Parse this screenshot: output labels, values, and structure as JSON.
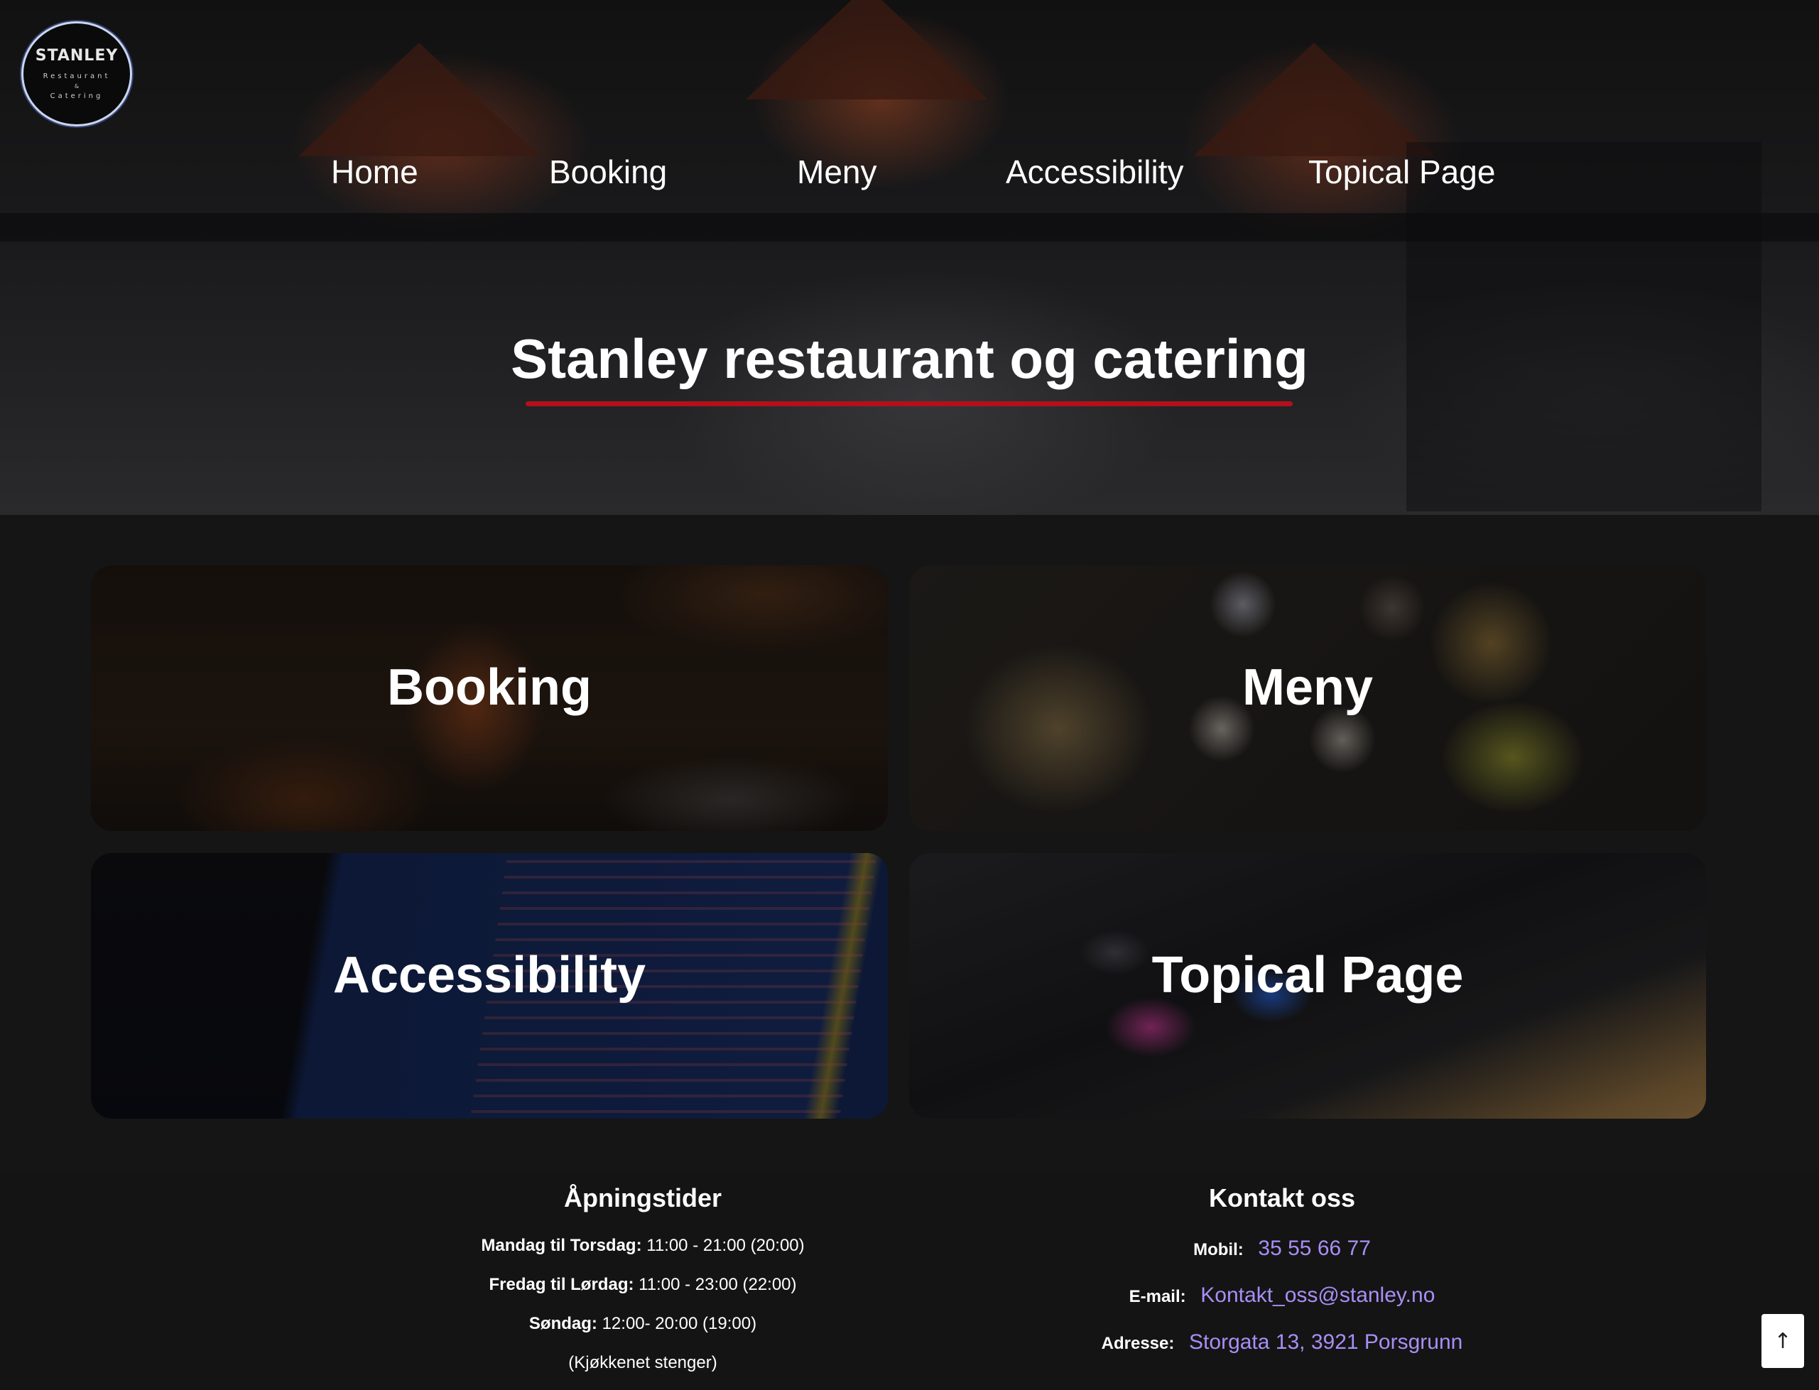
{
  "logo": {
    "name": "STANLEY",
    "line1": "Restaurant",
    "amp": "&",
    "line2": "Catering"
  },
  "nav": {
    "items": [
      {
        "label": "Home"
      },
      {
        "label": "Booking"
      },
      {
        "label": "Meny"
      },
      {
        "label": "Accessibility"
      },
      {
        "label": "Topical Page"
      }
    ]
  },
  "hero": {
    "title": "Stanley restaurant og catering"
  },
  "cards": [
    {
      "label": "Booking"
    },
    {
      "label": "Meny"
    },
    {
      "label": "Accessibility"
    },
    {
      "label": "Topical Page"
    }
  ],
  "footer": {
    "hours": {
      "heading": "Åpningstider",
      "rows": [
        {
          "day": "Mandag til Torsdag:",
          "time": "11:00 - 21:00 (20:00)"
        },
        {
          "day": "Fredag til Lørdag:",
          "time": "11:00 - 23:00 (22:00)"
        },
        {
          "day": "Søndag:",
          "time": "12:00- 20:00 (19:00)"
        }
      ],
      "note": "(Kjøkkenet stenger)"
    },
    "contact": {
      "heading": "Kontakt oss",
      "mobile_label": "Mobil:",
      "mobile_value": "35 55 66 77",
      "email_label": "E-mail:",
      "email_value": "Kontakt_oss@stanley.no",
      "address_label": "Adresse:",
      "address_value": "Storgata 13, 3921 Porsgrunn"
    }
  },
  "scroll_top": {
    "icon": "arrow-up-icon",
    "glyph": "↑"
  },
  "colors": {
    "accent_underline": "#b3101a",
    "link": "#a78ff5",
    "background": "#151515"
  }
}
